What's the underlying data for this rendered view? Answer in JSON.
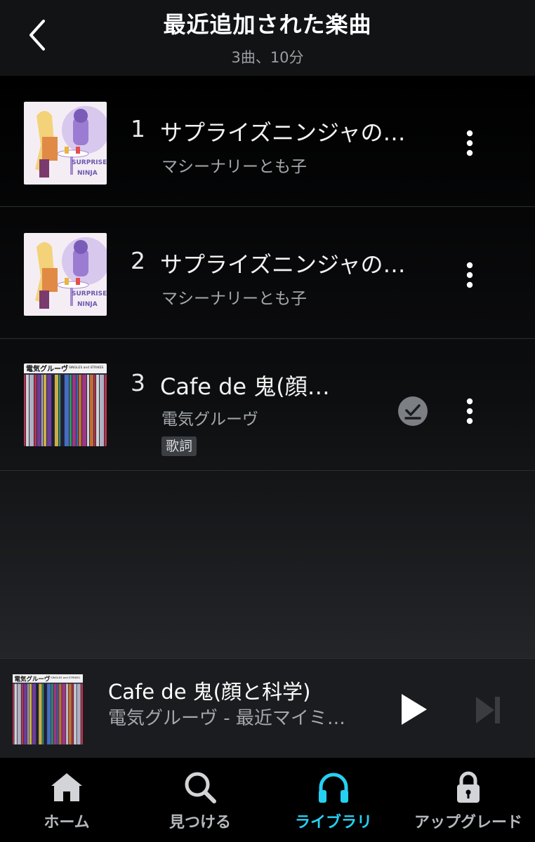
{
  "header": {
    "title": "最近追加された楽曲",
    "subtitle": "3曲、10分"
  },
  "tracks": [
    {
      "number": "1",
      "title": "サプライズニンジャの…",
      "artist": "マシーナリーとも子",
      "art_text": [
        "SURPRISE",
        "NINJA"
      ]
    },
    {
      "number": "2",
      "title": "サプライズニンジャの…",
      "artist": "マシーナリーとも子",
      "art_text": [
        "SURPRISE",
        "NINJA"
      ]
    },
    {
      "number": "3",
      "title": "Cafe de 鬼(顔…",
      "artist": "電気グルーヴ",
      "badge": "歌詞",
      "art_text": [
        "電気グルーヴ",
        "SINGLES and STRIKES"
      ],
      "downloaded": true
    }
  ],
  "now_playing": {
    "title": "Cafe de 鬼(顔と科学)",
    "subtitle": "電気グルーヴ - 最近マイミ…",
    "art_text": [
      "電気グルーヴ",
      "SINGLES and STRIKES"
    ]
  },
  "nav": [
    {
      "label": "ホーム",
      "icon": "home-icon",
      "active": false
    },
    {
      "label": "見つける",
      "icon": "search-icon",
      "active": false
    },
    {
      "label": "ライブラリ",
      "icon": "headphones-icon",
      "active": true
    },
    {
      "label": "アップグレード",
      "icon": "lock-icon",
      "active": false
    }
  ],
  "colors": {
    "accent": "#25d1f2",
    "background": "#000000",
    "header_bg": "#121315",
    "mini_player_bg": "#1b1c1f"
  }
}
